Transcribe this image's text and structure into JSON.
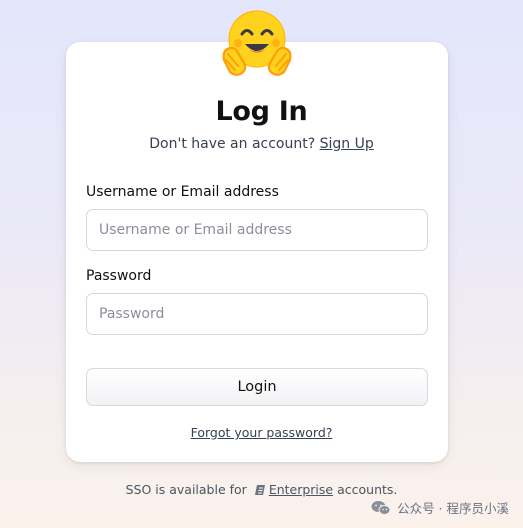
{
  "header": {
    "title": "Log In"
  },
  "subtitle": {
    "prefix": "Don't have an account?",
    "signup_link": "Sign Up"
  },
  "form": {
    "username": {
      "label": "Username or Email address",
      "placeholder": "Username or Email address",
      "value": ""
    },
    "password": {
      "label": "Password",
      "placeholder": "Password",
      "value": ""
    },
    "login_button": "Login",
    "forgot_link": "Forgot your password?"
  },
  "footer": {
    "sso_prefix": "SSO is available for",
    "enterprise_link": "Enterprise",
    "sso_suffix": "accounts."
  },
  "watermark": {
    "text": "公众号 · 程序员小溪"
  },
  "colors": {
    "background_top": "#e3e6fb",
    "background_bottom": "#fbf2ec",
    "logo_yellow": "#ffd21e",
    "logo_orange": "#ff9d0b"
  }
}
